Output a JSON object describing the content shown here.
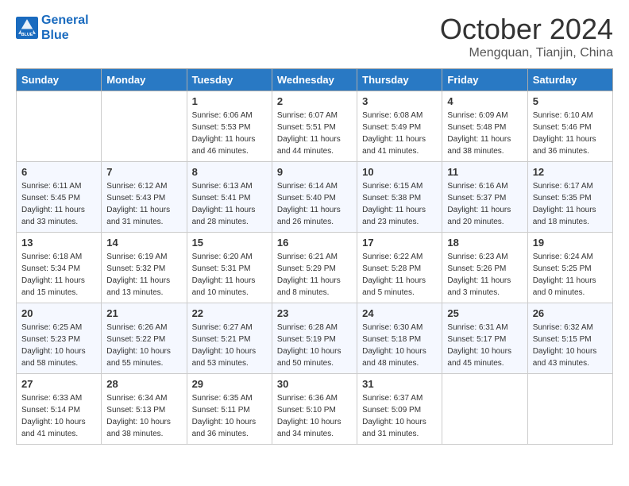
{
  "header": {
    "logo_line1": "General",
    "logo_line2": "Blue",
    "month": "October 2024",
    "location": "Mengquan, Tianjin, China"
  },
  "weekdays": [
    "Sunday",
    "Monday",
    "Tuesday",
    "Wednesday",
    "Thursday",
    "Friday",
    "Saturday"
  ],
  "weeks": [
    [
      {
        "day": "",
        "info": ""
      },
      {
        "day": "",
        "info": ""
      },
      {
        "day": "1",
        "info": "Sunrise: 6:06 AM\nSunset: 5:53 PM\nDaylight: 11 hours and 46 minutes."
      },
      {
        "day": "2",
        "info": "Sunrise: 6:07 AM\nSunset: 5:51 PM\nDaylight: 11 hours and 44 minutes."
      },
      {
        "day": "3",
        "info": "Sunrise: 6:08 AM\nSunset: 5:49 PM\nDaylight: 11 hours and 41 minutes."
      },
      {
        "day": "4",
        "info": "Sunrise: 6:09 AM\nSunset: 5:48 PM\nDaylight: 11 hours and 38 minutes."
      },
      {
        "day": "5",
        "info": "Sunrise: 6:10 AM\nSunset: 5:46 PM\nDaylight: 11 hours and 36 minutes."
      }
    ],
    [
      {
        "day": "6",
        "info": "Sunrise: 6:11 AM\nSunset: 5:45 PM\nDaylight: 11 hours and 33 minutes."
      },
      {
        "day": "7",
        "info": "Sunrise: 6:12 AM\nSunset: 5:43 PM\nDaylight: 11 hours and 31 minutes."
      },
      {
        "day": "8",
        "info": "Sunrise: 6:13 AM\nSunset: 5:41 PM\nDaylight: 11 hours and 28 minutes."
      },
      {
        "day": "9",
        "info": "Sunrise: 6:14 AM\nSunset: 5:40 PM\nDaylight: 11 hours and 26 minutes."
      },
      {
        "day": "10",
        "info": "Sunrise: 6:15 AM\nSunset: 5:38 PM\nDaylight: 11 hours and 23 minutes."
      },
      {
        "day": "11",
        "info": "Sunrise: 6:16 AM\nSunset: 5:37 PM\nDaylight: 11 hours and 20 minutes."
      },
      {
        "day": "12",
        "info": "Sunrise: 6:17 AM\nSunset: 5:35 PM\nDaylight: 11 hours and 18 minutes."
      }
    ],
    [
      {
        "day": "13",
        "info": "Sunrise: 6:18 AM\nSunset: 5:34 PM\nDaylight: 11 hours and 15 minutes."
      },
      {
        "day": "14",
        "info": "Sunrise: 6:19 AM\nSunset: 5:32 PM\nDaylight: 11 hours and 13 minutes."
      },
      {
        "day": "15",
        "info": "Sunrise: 6:20 AM\nSunset: 5:31 PM\nDaylight: 11 hours and 10 minutes."
      },
      {
        "day": "16",
        "info": "Sunrise: 6:21 AM\nSunset: 5:29 PM\nDaylight: 11 hours and 8 minutes."
      },
      {
        "day": "17",
        "info": "Sunrise: 6:22 AM\nSunset: 5:28 PM\nDaylight: 11 hours and 5 minutes."
      },
      {
        "day": "18",
        "info": "Sunrise: 6:23 AM\nSunset: 5:26 PM\nDaylight: 11 hours and 3 minutes."
      },
      {
        "day": "19",
        "info": "Sunrise: 6:24 AM\nSunset: 5:25 PM\nDaylight: 11 hours and 0 minutes."
      }
    ],
    [
      {
        "day": "20",
        "info": "Sunrise: 6:25 AM\nSunset: 5:23 PM\nDaylight: 10 hours and 58 minutes."
      },
      {
        "day": "21",
        "info": "Sunrise: 6:26 AM\nSunset: 5:22 PM\nDaylight: 10 hours and 55 minutes."
      },
      {
        "day": "22",
        "info": "Sunrise: 6:27 AM\nSunset: 5:21 PM\nDaylight: 10 hours and 53 minutes."
      },
      {
        "day": "23",
        "info": "Sunrise: 6:28 AM\nSunset: 5:19 PM\nDaylight: 10 hours and 50 minutes."
      },
      {
        "day": "24",
        "info": "Sunrise: 6:30 AM\nSunset: 5:18 PM\nDaylight: 10 hours and 48 minutes."
      },
      {
        "day": "25",
        "info": "Sunrise: 6:31 AM\nSunset: 5:17 PM\nDaylight: 10 hours and 45 minutes."
      },
      {
        "day": "26",
        "info": "Sunrise: 6:32 AM\nSunset: 5:15 PM\nDaylight: 10 hours and 43 minutes."
      }
    ],
    [
      {
        "day": "27",
        "info": "Sunrise: 6:33 AM\nSunset: 5:14 PM\nDaylight: 10 hours and 41 minutes."
      },
      {
        "day": "28",
        "info": "Sunrise: 6:34 AM\nSunset: 5:13 PM\nDaylight: 10 hours and 38 minutes."
      },
      {
        "day": "29",
        "info": "Sunrise: 6:35 AM\nSunset: 5:11 PM\nDaylight: 10 hours and 36 minutes."
      },
      {
        "day": "30",
        "info": "Sunrise: 6:36 AM\nSunset: 5:10 PM\nDaylight: 10 hours and 34 minutes."
      },
      {
        "day": "31",
        "info": "Sunrise: 6:37 AM\nSunset: 5:09 PM\nDaylight: 10 hours and 31 minutes."
      },
      {
        "day": "",
        "info": ""
      },
      {
        "day": "",
        "info": ""
      }
    ]
  ]
}
